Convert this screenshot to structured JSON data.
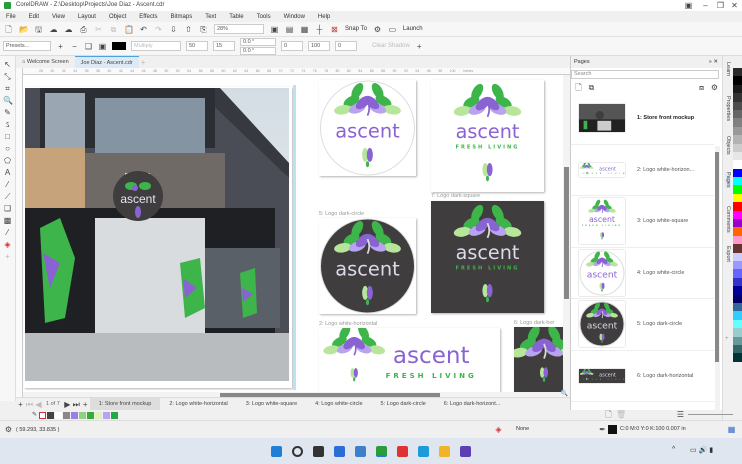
{
  "app": {
    "title": "CorelDRAW - Z:\\Desktop\\Projects\\Joe Diaz - Ascent.cdr"
  },
  "menu": [
    "File",
    "Edit",
    "View",
    "Layout",
    "Object",
    "Effects",
    "Bitmaps",
    "Text",
    "Table",
    "Tools",
    "Window",
    "Help"
  ],
  "toolbar": {
    "zoom": "28%",
    "snap_to": "Snap To",
    "launch": "Launch"
  },
  "propbar": {
    "presets": "Presets...",
    "merge_mode": "Multiply",
    "opacity": "50",
    "feather": "15",
    "angle1": "0.0 °",
    "angle2": "0.0 °",
    "v1": "0",
    "v2": "100",
    "v3": "0",
    "clear_shadow": "Clear Shadow"
  },
  "doc_tabs": {
    "welcome": "Welcome Screen",
    "document": "Joe Diaz - Ascent.cdr"
  },
  "ruler_ticks": [
    "28",
    "30",
    "32",
    "34",
    "36",
    "38",
    "40",
    "42",
    "44",
    "46",
    "48",
    "50",
    "52",
    "54",
    "56",
    "58",
    "60",
    "62",
    "64",
    "66",
    "68",
    "70",
    "72",
    "74",
    "76",
    "78",
    "80",
    "82",
    "84",
    "86",
    "88",
    "90",
    "92",
    "94",
    "96",
    "98",
    "100",
    "inches"
  ],
  "logo": {
    "word": "ascent",
    "tagline": "FRESH LIVING"
  },
  "canvas_labels": {
    "dark_square": "7: Logo dark-square",
    "dark_circle": "5: Logo dark-circle",
    "white_horizontal": "2: Logo white-horizontal",
    "dark_horizontal": "6: Logo dark-hor"
  },
  "pages_panel": {
    "title": "Pages",
    "search_placeholder": "Search",
    "items": [
      {
        "label": "1: Store front mockup",
        "kind": "photo"
      },
      {
        "label": "2: Logo white-horizon...",
        "kind": "white-horizontal"
      },
      {
        "label": "3: Logo white-square",
        "kind": "white-square"
      },
      {
        "label": "4: Logo white-circle",
        "kind": "white-circle"
      },
      {
        "label": "5: Logo dark-circle",
        "kind": "dark-circle"
      },
      {
        "label": "6: Logo dark-horizontal",
        "kind": "dark-horizontal"
      }
    ]
  },
  "docker_tabs": [
    "Learn",
    "Properties",
    "Objects",
    "Pages",
    "Comments",
    "Export"
  ],
  "palette_colors": [
    "#2a2a2a",
    "#000000",
    "#1a1a1a",
    "#333333",
    "#4d4d4d",
    "#666666",
    "#808080",
    "#999999",
    "#b3b3b3",
    "#cccccc",
    "#e6e6e6",
    "#ffffff",
    "#0000ff",
    "#00ffff",
    "#00ff00",
    "#ffff00",
    "#ff0000",
    "#ff00ff",
    "#9900cc",
    "#ff6600",
    "#ff99cc",
    "#663333",
    "#ccccff",
    "#9999ff",
    "#6666ff",
    "#3333cc",
    "#000099",
    "#000066",
    "#336699",
    "#33ccff",
    "#66ffff",
    "#99cccc",
    "#669999",
    "#336666",
    "#003333"
  ],
  "page_nav": {
    "counter": "1 of 7"
  },
  "page_tabs": [
    "1: Store front mockup",
    "2: Logo white-horizontal",
    "3: Logo white-square",
    "4: Logo white-circle",
    "5: Logo dark-circle",
    "6: Logo dark-horizont..."
  ],
  "doc_palette": [
    "#444444",
    "#ffffff",
    "#888888",
    "#9b7fe6",
    "#8fd17f",
    "#3aaa35",
    "#e0f0c0",
    "#b9a3f0",
    "#27a844"
  ],
  "status": {
    "coords": "( 59.293, 33.835 )",
    "fill": "None",
    "outline": "C:0 M:0 Y:0 K:100  0.007 in"
  },
  "colors": {
    "accent": "#4aa3df",
    "logo_purple": "#8a63d2",
    "logo_green": "#3db54a",
    "logo_light_green": "#b7e69a",
    "dark_bg": "#3f3d3e"
  }
}
